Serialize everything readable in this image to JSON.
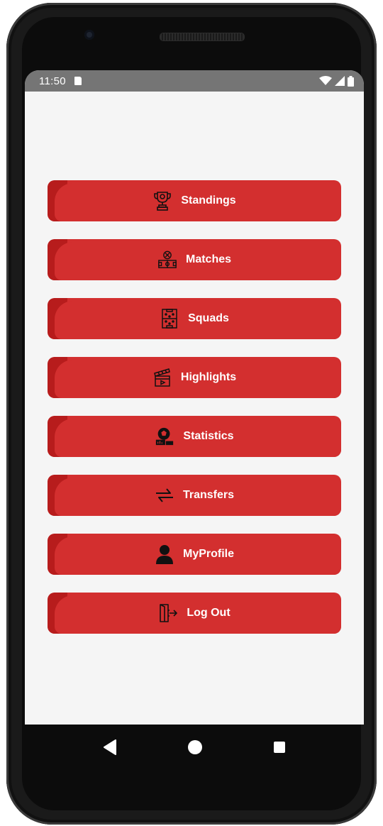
{
  "status_bar": {
    "time": "11:50",
    "icons": [
      "sd-card-icon",
      "wifi-icon",
      "signal-icon",
      "battery-icon"
    ]
  },
  "menu": {
    "items": [
      {
        "label": "Standings",
        "icon": "trophy-icon"
      },
      {
        "label": "Matches",
        "icon": "football-field-icon"
      },
      {
        "label": "Squads",
        "icon": "formation-board-icon"
      },
      {
        "label": "Highlights",
        "icon": "clapperboard-icon"
      },
      {
        "label": "Statistics",
        "icon": "ball-stats-icon"
      },
      {
        "label": "Transfers",
        "icon": "transfer-arrows-icon"
      },
      {
        "label": "MyProfile",
        "icon": "user-icon"
      },
      {
        "label": "Log Out",
        "icon": "logout-icon"
      }
    ]
  },
  "nav_bar": {
    "icons": [
      "back-icon",
      "home-icon",
      "recents-icon"
    ]
  },
  "colors": {
    "button": "#d32f2f",
    "button_dark": "#b71c1c",
    "background": "#f5f5f5",
    "status_bar": "#757575"
  }
}
